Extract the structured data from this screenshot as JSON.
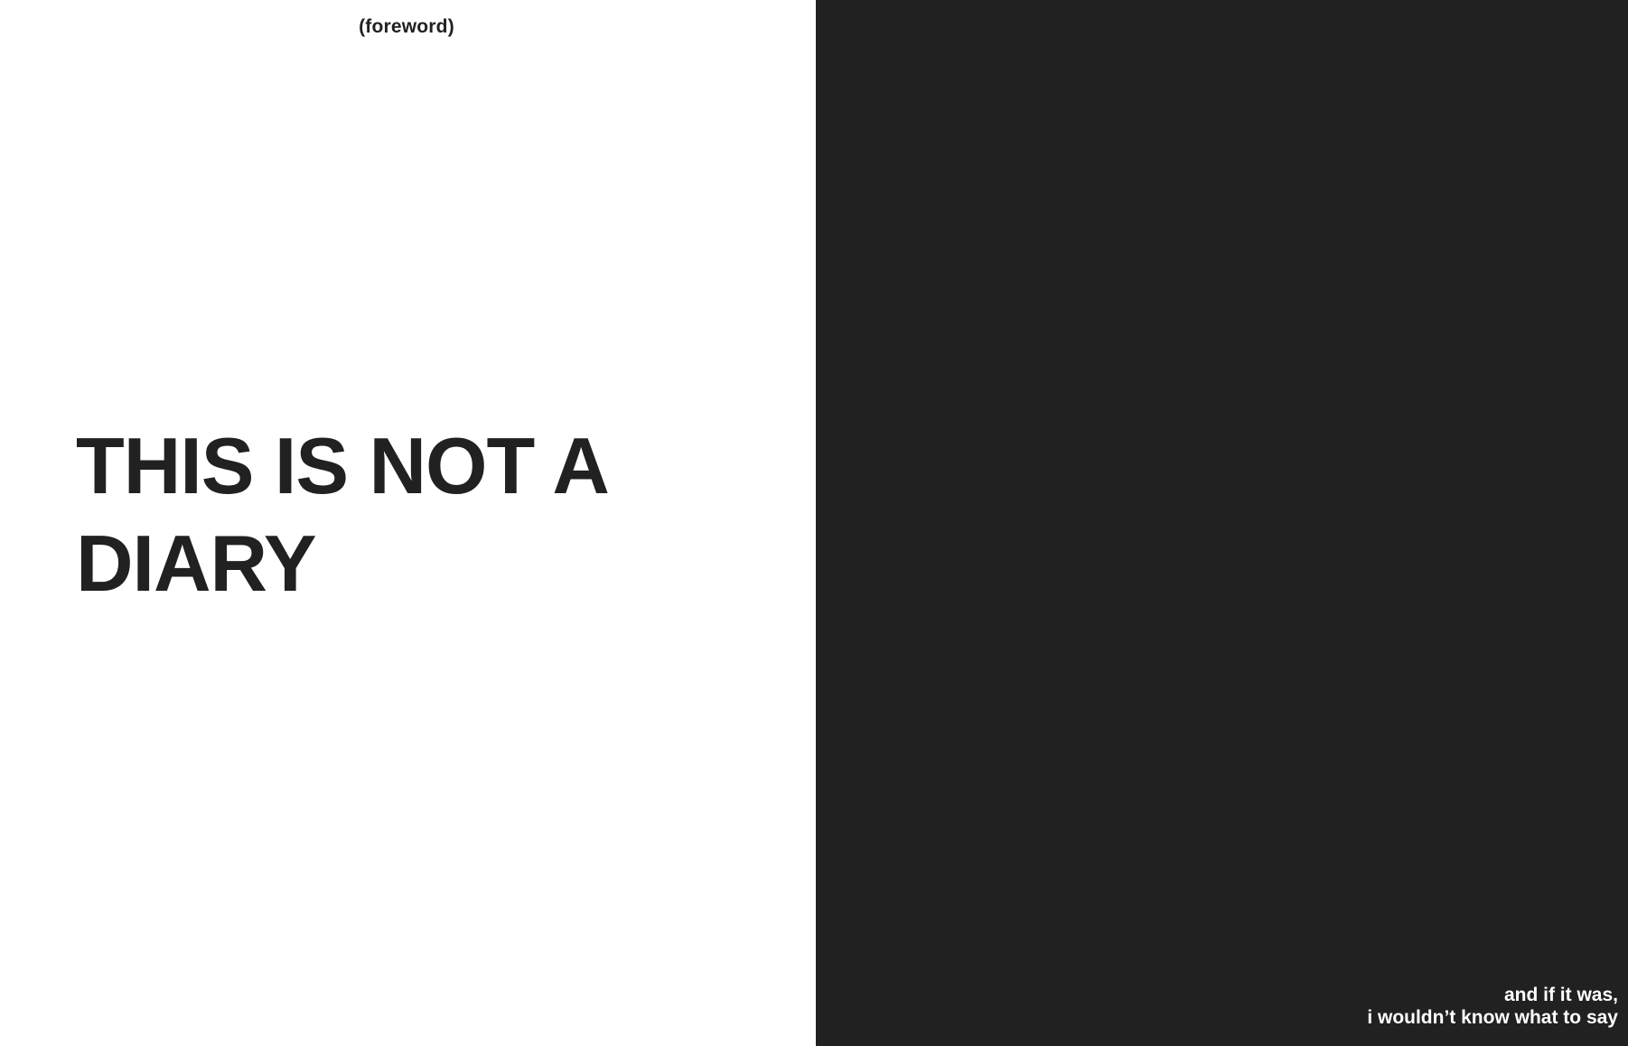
{
  "left_page": {
    "label": "(foreword)",
    "headline": {
      "line1": "THIS IS NOT A",
      "line2": "DIARY"
    }
  },
  "right_page": {
    "caption": {
      "line1": "and if it was,",
      "line2": "i wouldn’t know what to say"
    }
  },
  "colors": {
    "background_left": "#ffffff",
    "background_right": "#222122",
    "text_dark": "#222122",
    "text_light": "#ffffff"
  }
}
